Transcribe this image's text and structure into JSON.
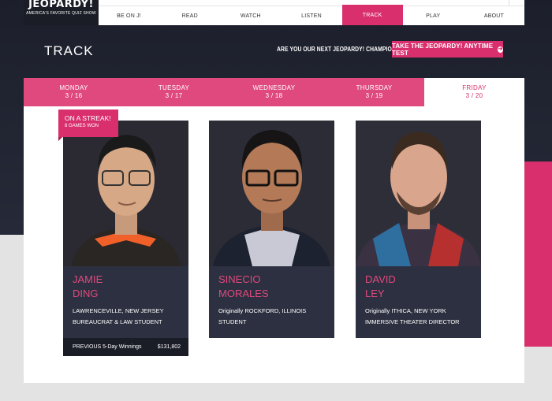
{
  "logo": {
    "title": "JEOPARDY!",
    "subtitle": "AMERICA'S FAVORITE QUIZ SHOW"
  },
  "nav": {
    "items": [
      "BE ON J!",
      "READ",
      "WATCH",
      "LISTEN",
      "TRACK",
      "PLAY",
      "ABOUT"
    ],
    "active": "TRACK"
  },
  "page": {
    "title": "TRACK",
    "champion_prompt": "ARE YOU OUR NEXT JEOPARDY! CHAMPION?",
    "test_button": "TAKE THE JEOPARDY! ANYTIME TEST"
  },
  "days": [
    {
      "day": "MONDAY",
      "date": "3 / 16"
    },
    {
      "day": "TUESDAY",
      "date": "3 / 17"
    },
    {
      "day": "WEDNESDAY",
      "date": "3 / 18"
    },
    {
      "day": "THURSDAY",
      "date": "3 / 19"
    },
    {
      "day": "FRIDAY",
      "date": "3 / 20"
    }
  ],
  "selected_day": "FRIDAY",
  "streak": {
    "label": "ON A STREAK!",
    "games": "8 GAMES WON"
  },
  "contestants": [
    {
      "first": "JAMIE",
      "last": "DING",
      "line1": "LAWRENCEVILLE, NEW JERSEY",
      "line2": "BUREAUCRAT & LAW STUDENT",
      "winnings_label": "PREVIOUS 5-Day Winnings",
      "winnings": "$131,802"
    },
    {
      "first": "SINECIO",
      "last": "MORALES",
      "line1": "Originally ROCKFORD, ILLINOIS",
      "line2": "STUDENT"
    },
    {
      "first": "DAVID",
      "last": "LEY",
      "line1": "Originally ITHICA, NEW YORK",
      "line2": "IMMERSIVE THEATER DIRECTOR"
    }
  ],
  "colors": {
    "accent": "#d9306d",
    "tab_bar": "#e0497e",
    "card_bg": "#2d3040",
    "hero_bg": "#1c1f2b"
  }
}
